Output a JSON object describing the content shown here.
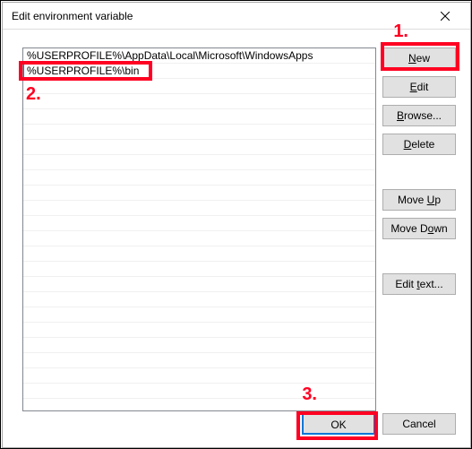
{
  "window": {
    "title": "Edit environment variable"
  },
  "list": {
    "row0": "%USERPROFILE%\\AppData\\Local\\Microsoft\\WindowsApps",
    "row1": "%USERPROFILE%\\bin"
  },
  "buttons": {
    "new_prefix": "N",
    "new_rest": "ew",
    "edit_prefix": "E",
    "edit_rest": "dit",
    "browse_prefix": "B",
    "browse_rest": "rowse...",
    "delete_prefix": "D",
    "delete_rest": "elete",
    "moveup": "Move ",
    "moveup_u": "U",
    "moveup_rest": "p",
    "movedown": "Move D",
    "movedown_u": "o",
    "movedown_rest": "wn",
    "edittext": "Edit ",
    "edittext_u": "t",
    "edittext_rest": "ext...",
    "ok": "OK",
    "cancel": "Cancel"
  },
  "annotations": {
    "one": "1.",
    "two": "2.",
    "three": "3."
  }
}
